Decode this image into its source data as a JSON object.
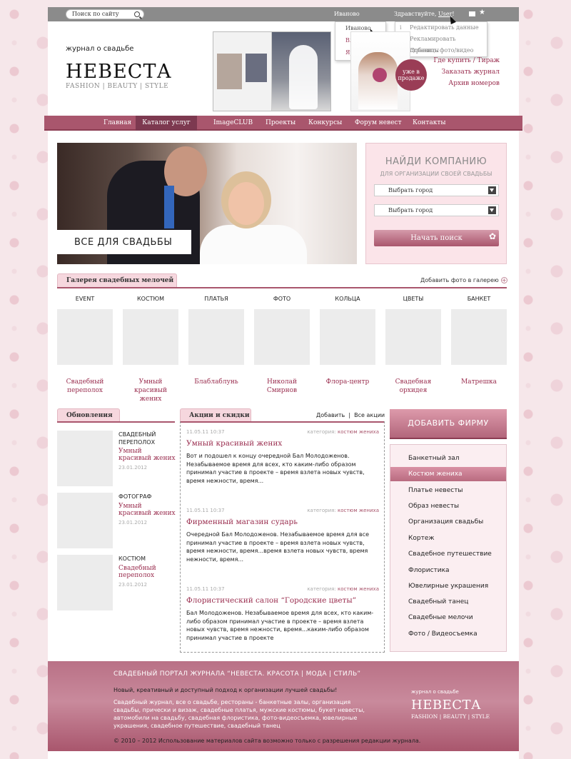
{
  "topbar": {
    "search_placeholder": "Поиск по сайту",
    "current_city": "Иваново",
    "greeting": "Здравствуйте, ",
    "user": "User",
    "greeting_end": "!"
  },
  "city_dropdown": [
    "Иваново",
    "Владимир",
    "Ярославль"
  ],
  "user_dropdown": [
    {
      "icon": "info-icon",
      "label": "Редактировать данные"
    },
    {
      "icon": "globe-icon",
      "label": "Рекламировать страницы"
    },
    {
      "icon": "plus-icon",
      "label": "Добавить фото/видео"
    }
  ],
  "header": {
    "tagline": "журнал о свадьбе",
    "logo": "НЕВЕСТА",
    "logo_sub": "FASHION | BEAUTY | STYLE",
    "badge": "уже в продаже",
    "links": [
      "Где купить / Тираж",
      "Заказать журнал",
      "Архив номеров"
    ]
  },
  "nav": [
    "Главная",
    "Каталог услуг",
    "ImageCLUB",
    "Проекты",
    "Конкурсы",
    "Форум невест",
    "Контакты"
  ],
  "nav_active": "Каталог услуг",
  "hero": {
    "label": "ВСЕ ДЛЯ СВАДЬБЫ"
  },
  "finder": {
    "title": "НАЙДИ КОМПАНИЮ",
    "subtitle": "ДЛЯ ОРГАНИЗАЦИИ СВОЕЙ СВАДЬБЫ",
    "select1": "Выбрать город",
    "select2": "Выбрать город",
    "button": "Начать поиск"
  },
  "gallery": {
    "title": "Галерея свадебных мелочей",
    "add_link": "Добавить фото в галерею",
    "items": [
      {
        "cat": "EVENT",
        "name": "Свадебный переполох"
      },
      {
        "cat": "КОСТЮМ",
        "name": "Умный красивый жених"
      },
      {
        "cat": "ПЛАТЬЯ",
        "name": "Блаблаблунь"
      },
      {
        "cat": "ФОТО",
        "name": "Николай Смирнов"
      },
      {
        "cat": "КОЛЬЦА",
        "name": "Флора-центр"
      },
      {
        "cat": "ЦВЕТЫ",
        "name": "Свадебная орхидея"
      },
      {
        "cat": "БАНКЕТ",
        "name": "Матрешка"
      }
    ]
  },
  "updates": {
    "title": "Обновления",
    "items": [
      {
        "cat": "СВАДЕБНЫЙ ПЕРЕПОЛОХ",
        "name": "Умный красивый жених",
        "date": "23.01.2012"
      },
      {
        "cat": "ФОТОГРАФ",
        "name": "Умный красивый жених",
        "date": "23.01.2012"
      },
      {
        "cat": "КОСТЮМ",
        "name": "Свадебный переполох",
        "date": "23.01.2012"
      }
    ]
  },
  "news": {
    "title": "Акции и скидки",
    "add": "Добавить",
    "sep": "|",
    "all": "Все акции",
    "category_label": "категория:",
    "items": [
      {
        "date": "11.05.11 10:37",
        "category": "костюм жениха",
        "title": "Умный красивый жених",
        "text": "Вот и подошел к концу очередной Бал Молодоженов. Незабываемое время для всех, кто каким-либо образом принимал участие в проекте – время взлета новых чувств, время нежности, время..."
      },
      {
        "date": "11.05.11 10:37",
        "category": "костюм жениха",
        "title": "Фирменный магазин сударь",
        "text": "Очередной Бал Молодоженов. Незабываемое время для все принимал участие в проекте – время взлета новых чувств, время нежности, время...время взлета новых чувств, время нежности, время..."
      },
      {
        "date": "11.05.11 10:37",
        "category": "костюм жениха",
        "title": "Флористический салон “Городские цветы”",
        "text": "Бал Молодоженов. Незабываемое время для всех, кто каким-либо образом принимал участие в проекте – время взлета новых чувств, время нежности, время...каким-либо образом принимал участие в проекте"
      }
    ]
  },
  "sidebar": {
    "add_firm": "ДОБАВИТЬ ФИРМУ",
    "categories": [
      "Банкетный зал",
      "Костюм жениха",
      "Платье невесты",
      "Образ невесты",
      "Организация свадьбы",
      "Кортеж",
      "Свадебное путешествие",
      "Флористика",
      "Ювелирные украшения",
      "Свадебный танец",
      "Свадебные мелочи",
      "Фото / Видеосъемка"
    ],
    "active": "Костюм жениха"
  },
  "footer": {
    "title": "СВАДЕБНЫЙ ПОРТАЛ ЖУРНАЛА “НЕВЕСТА. КРАСОТА | МОДА | СТИЛЬ”",
    "lead": "Новый, креативный и доступный подход к организации лучшей свадьбы!",
    "keywords": "Свадебный журнал, все о свадьбе, рестораны - банкетные залы, организация свадьбы, прически и визаж, свадебные платья, мужские костюмы, букет невесты, автомобили на свадьбу, свадебная флористика, фото-видеосъемка, ювелирные украшения, свадебное путешествие, свадебный танец",
    "copyright": "© 2010 – 2012 Использование материалов сайта возможно только с разрешения редакции журнала.",
    "small": "журнал о свадьбе",
    "logo": "НЕВЕСТА",
    "logo_sub": "FASHION | BEAUTY | STYLE"
  },
  "colors": {
    "accent": "#a9566d",
    "link": "#9a2e4f",
    "panel": "#fbe4e9"
  }
}
